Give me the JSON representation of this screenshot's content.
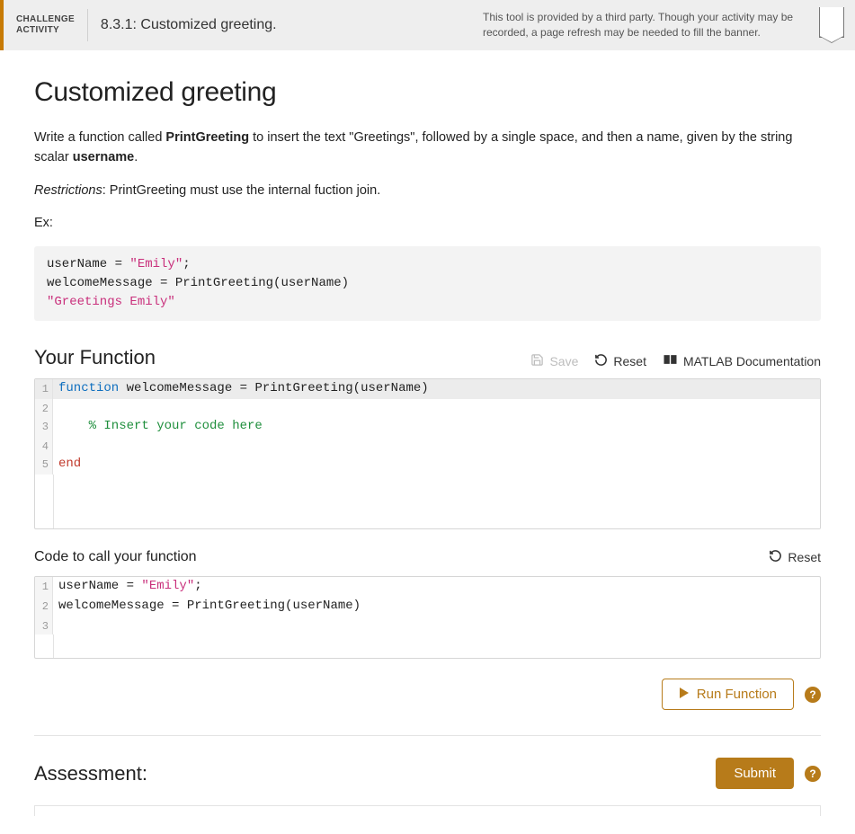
{
  "banner": {
    "badge_line1": "CHALLENGE",
    "badge_line2": "ACTIVITY",
    "title": "8.3.1: Customized greeting.",
    "note": "This tool is provided by a third party. Though your activity may be recorded, a page refresh may be needed to fill the banner."
  },
  "page": {
    "title": "Customized greeting",
    "instruction_prefix": "Write a function called ",
    "instruction_func": "PrintGreeting",
    "instruction_mid": " to insert the text \"Greetings\", followed by a single space, and then a name, given by the string scalar ",
    "instruction_var": "username",
    "instruction_end": ".",
    "restriction_label": "Restrictions",
    "restriction_text": ":  PrintGreeting must use the internal fuction join.",
    "example_label": "Ex:"
  },
  "example": {
    "l1_a": "userName = ",
    "l1_b": "\"Emily\"",
    "l1_c": ";",
    "l2": "welcomeMessage = PrintGreeting(userName)",
    "l3": "\"Greetings Emily\""
  },
  "your_function": {
    "heading": "Your Function",
    "save": "Save",
    "reset": "Reset",
    "docs": "MATLAB Documentation"
  },
  "editor1": {
    "l1_kw": "function",
    "l1_rest": " welcomeMessage = PrintGreeting(userName)",
    "l3_comment": "    % Insert your code here",
    "l5_end": "end"
  },
  "call": {
    "heading": "Code to call your function",
    "reset": "Reset"
  },
  "editor2": {
    "l1_a": "userName = ",
    "l1_b": "\"Emily\"",
    "l1_c": ";",
    "l2": "welcomeMessage = PrintGreeting(userName)"
  },
  "actions": {
    "run": "Run Function",
    "help": "?",
    "assessment": "Assessment:",
    "submit": "Submit"
  }
}
